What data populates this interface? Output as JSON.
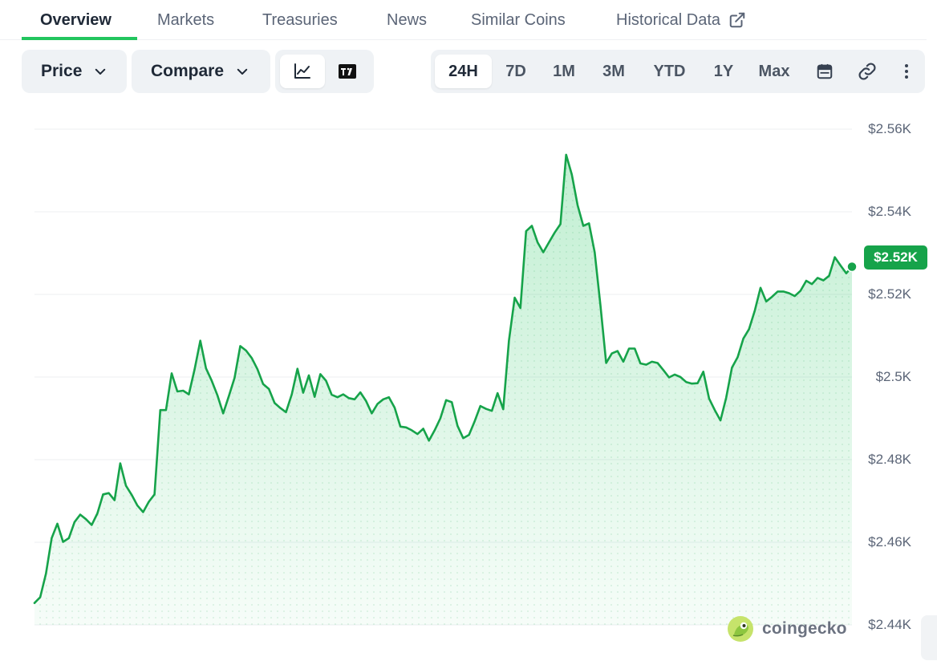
{
  "tabs": [
    {
      "label": "Overview",
      "active": true
    },
    {
      "label": "Markets"
    },
    {
      "label": "Treasuries"
    },
    {
      "label": "News"
    },
    {
      "label": "Similar Coins"
    },
    {
      "label": "Historical Data",
      "icon": "external-link-icon"
    }
  ],
  "toolbar": {
    "price_label": "Price",
    "compare_label": "Compare",
    "chart_types": [
      {
        "icon": "line-chart-icon",
        "active": true
      },
      {
        "icon": "tradingview-icon"
      }
    ],
    "ranges": [
      "24H",
      "7D",
      "1M",
      "3M",
      "YTD",
      "1Y",
      "Max"
    ],
    "active_range": "24H",
    "extra_icons": [
      "calendar-icon",
      "link-icon",
      "more-vertical-icon"
    ]
  },
  "colors": {
    "line": "#16a34a",
    "accent": "#22c55e",
    "badge": "#16a34a"
  },
  "current_price_badge": "$2.52K",
  "watermark": {
    "text": "coingecko",
    "icon": "coingecko-logo-icon"
  },
  "chart_data": {
    "type": "area",
    "y_ticks": [
      "$2.56K",
      "$2.54K",
      "$2.52K",
      "$2.5K",
      "$2.48K",
      "$2.46K",
      "$2.44K"
    ],
    "ylim": [
      2440,
      2560
    ],
    "y_unit": "USD",
    "grid": true,
    "series": [
      {
        "values": [
          2445.3,
          2446.7,
          2452.4,
          2461.0,
          2464.5,
          2460.1,
          2461.0,
          2464.9,
          2466.7,
          2465.6,
          2464.2,
          2467.0,
          2471.6,
          2471.9,
          2470.2,
          2479.1,
          2473.7,
          2471.5,
          2468.9,
          2467.3,
          2469.8,
          2471.6,
          2492.0,
          2492.0,
          2500.9,
          2496.5,
          2496.7,
          2495.8,
          2501.8,
          2508.8,
          2502.1,
          2499.1,
          2495.6,
          2491.2,
          2495.4,
          2499.8,
          2507.5,
          2506.4,
          2504.6,
          2501.9,
          2498.3,
          2497.1,
          2493.7,
          2492.5,
          2491.5,
          2495.8,
          2502.0,
          2496.2,
          2500.4,
          2495.2,
          2500.7,
          2499.1,
          2495.7,
          2495.1,
          2495.8,
          2494.9,
          2494.6,
          2496.3,
          2494.2,
          2491.2,
          2493.5,
          2494.6,
          2495.1,
          2492.6,
          2488.0,
          2487.8,
          2487.1,
          2486.2,
          2487.5,
          2484.6,
          2487.1,
          2490.0,
          2494.4,
          2493.9,
          2488.2,
          2485.2,
          2486.0,
          2489.3,
          2493.0,
          2492.3,
          2491.8,
          2496.1,
          2492.2,
          2508.8,
          2519.2,
          2516.7,
          2535.3,
          2536.6,
          2532.6,
          2530.2,
          2532.6,
          2535.0,
          2537.0,
          2553.8,
          2549.0,
          2541.6,
          2536.6,
          2537.2,
          2530.2,
          2517.3,
          2503.4,
          2505.7,
          2506.3,
          2503.7,
          2506.9,
          2506.9,
          2503.3,
          2503.0,
          2503.7,
          2503.4,
          2501.7,
          2499.9,
          2500.6,
          2500.0,
          2498.8,
          2498.4,
          2498.5,
          2501.3,
          2494.8,
          2492.0,
          2489.5,
          2495.0,
          2502.3,
          2504.8,
          2509.3,
          2511.6,
          2516.1,
          2521.6,
          2518.3,
          2519.4,
          2520.7,
          2520.7,
          2520.3,
          2519.6,
          2520.9,
          2523.3,
          2522.5,
          2524.0,
          2523.4,
          2524.5,
          2529.0,
          2527.0,
          2525.1,
          2526.7
        ]
      }
    ]
  }
}
